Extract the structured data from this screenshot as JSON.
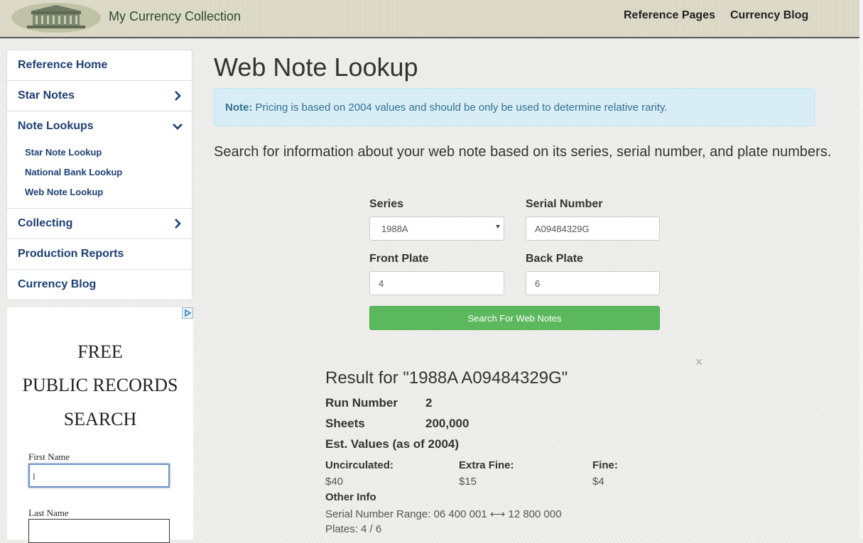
{
  "header": {
    "brand": "My Currency Collection",
    "nav": [
      "Reference Pages",
      "Currency Blog"
    ]
  },
  "sidebar": {
    "items": [
      {
        "label": "Reference Home"
      },
      {
        "label": "Star Notes"
      },
      {
        "label": "Note Lookups"
      },
      {
        "label": "Collecting"
      },
      {
        "label": "Production Reports"
      },
      {
        "label": "Currency Blog"
      }
    ],
    "sub_items": [
      "Star Note Lookup",
      "National Bank Lookup",
      "Web Note Lookup"
    ]
  },
  "ad": {
    "title_lines": [
      "FREE",
      "PUBLIC RECORDS",
      "SEARCH"
    ],
    "first_name_label": "First Name",
    "last_name_label": "Last Name",
    "caret": "I"
  },
  "main": {
    "title": "Web Note Lookup",
    "alert_strong": "Note:",
    "alert_text": "Pricing is based on 2004 values and should be only be used to determine relative rarity.",
    "intro": "Search for information about your web note based on its series, serial number, and plate numbers."
  },
  "form": {
    "series_label": "Series",
    "series_value": "1988A",
    "serial_label": "Serial Number",
    "serial_value": "A09484329G",
    "front_label": "Front Plate",
    "front_value": "4",
    "back_label": "Back Plate",
    "back_value": "6",
    "submit_label": "Search For Web Notes"
  },
  "result": {
    "close": "×",
    "title": "Result for \"1988A A09484329G\"",
    "run_label": "Run Number",
    "run_value": "2",
    "sheets_label": "Sheets",
    "sheets_value": "200,000",
    "values_heading": "Est. Values (as of 2004)",
    "grades": [
      {
        "label": "Uncirculated:",
        "value": "$40"
      },
      {
        "label": "Extra Fine:",
        "value": "$15"
      },
      {
        "label": "Fine:",
        "value": "$4"
      }
    ],
    "other_heading": "Other Info",
    "serial_range": "Serial Number Range: 06 400 001 ⟷ 12 800 000",
    "plates": "Plates: 4 / 6"
  },
  "colors": {
    "link": "#1d3f73",
    "button": "#5cb85c",
    "alert_bg": "#d9edf7",
    "alert_text": "#31708f"
  }
}
